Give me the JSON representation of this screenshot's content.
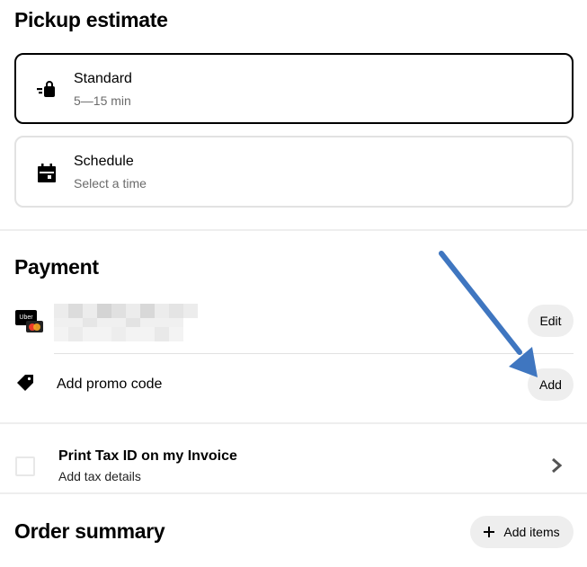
{
  "pickup": {
    "title": "Pickup estimate",
    "options": [
      {
        "title": "Standard",
        "subtitle": "5—15 min",
        "icon": "bag-bolt-icon",
        "selected": true
      },
      {
        "title": "Schedule",
        "subtitle": "Select a time",
        "icon": "calendar-icon",
        "selected": false
      }
    ]
  },
  "payment": {
    "title": "Payment",
    "card_logo": "Uber",
    "edit_label": "Edit",
    "promo_label": "Add promo code",
    "promo_add_label": "Add"
  },
  "tax": {
    "title": "Print Tax ID on my Invoice",
    "subtitle": "Add tax details"
  },
  "order_summary": {
    "title": "Order summary",
    "add_items_label": "Add items"
  },
  "colors": {
    "annotation_arrow": "#3f76c0",
    "pill_bg": "#eeeeee",
    "muted_text": "#6b6b6b"
  }
}
